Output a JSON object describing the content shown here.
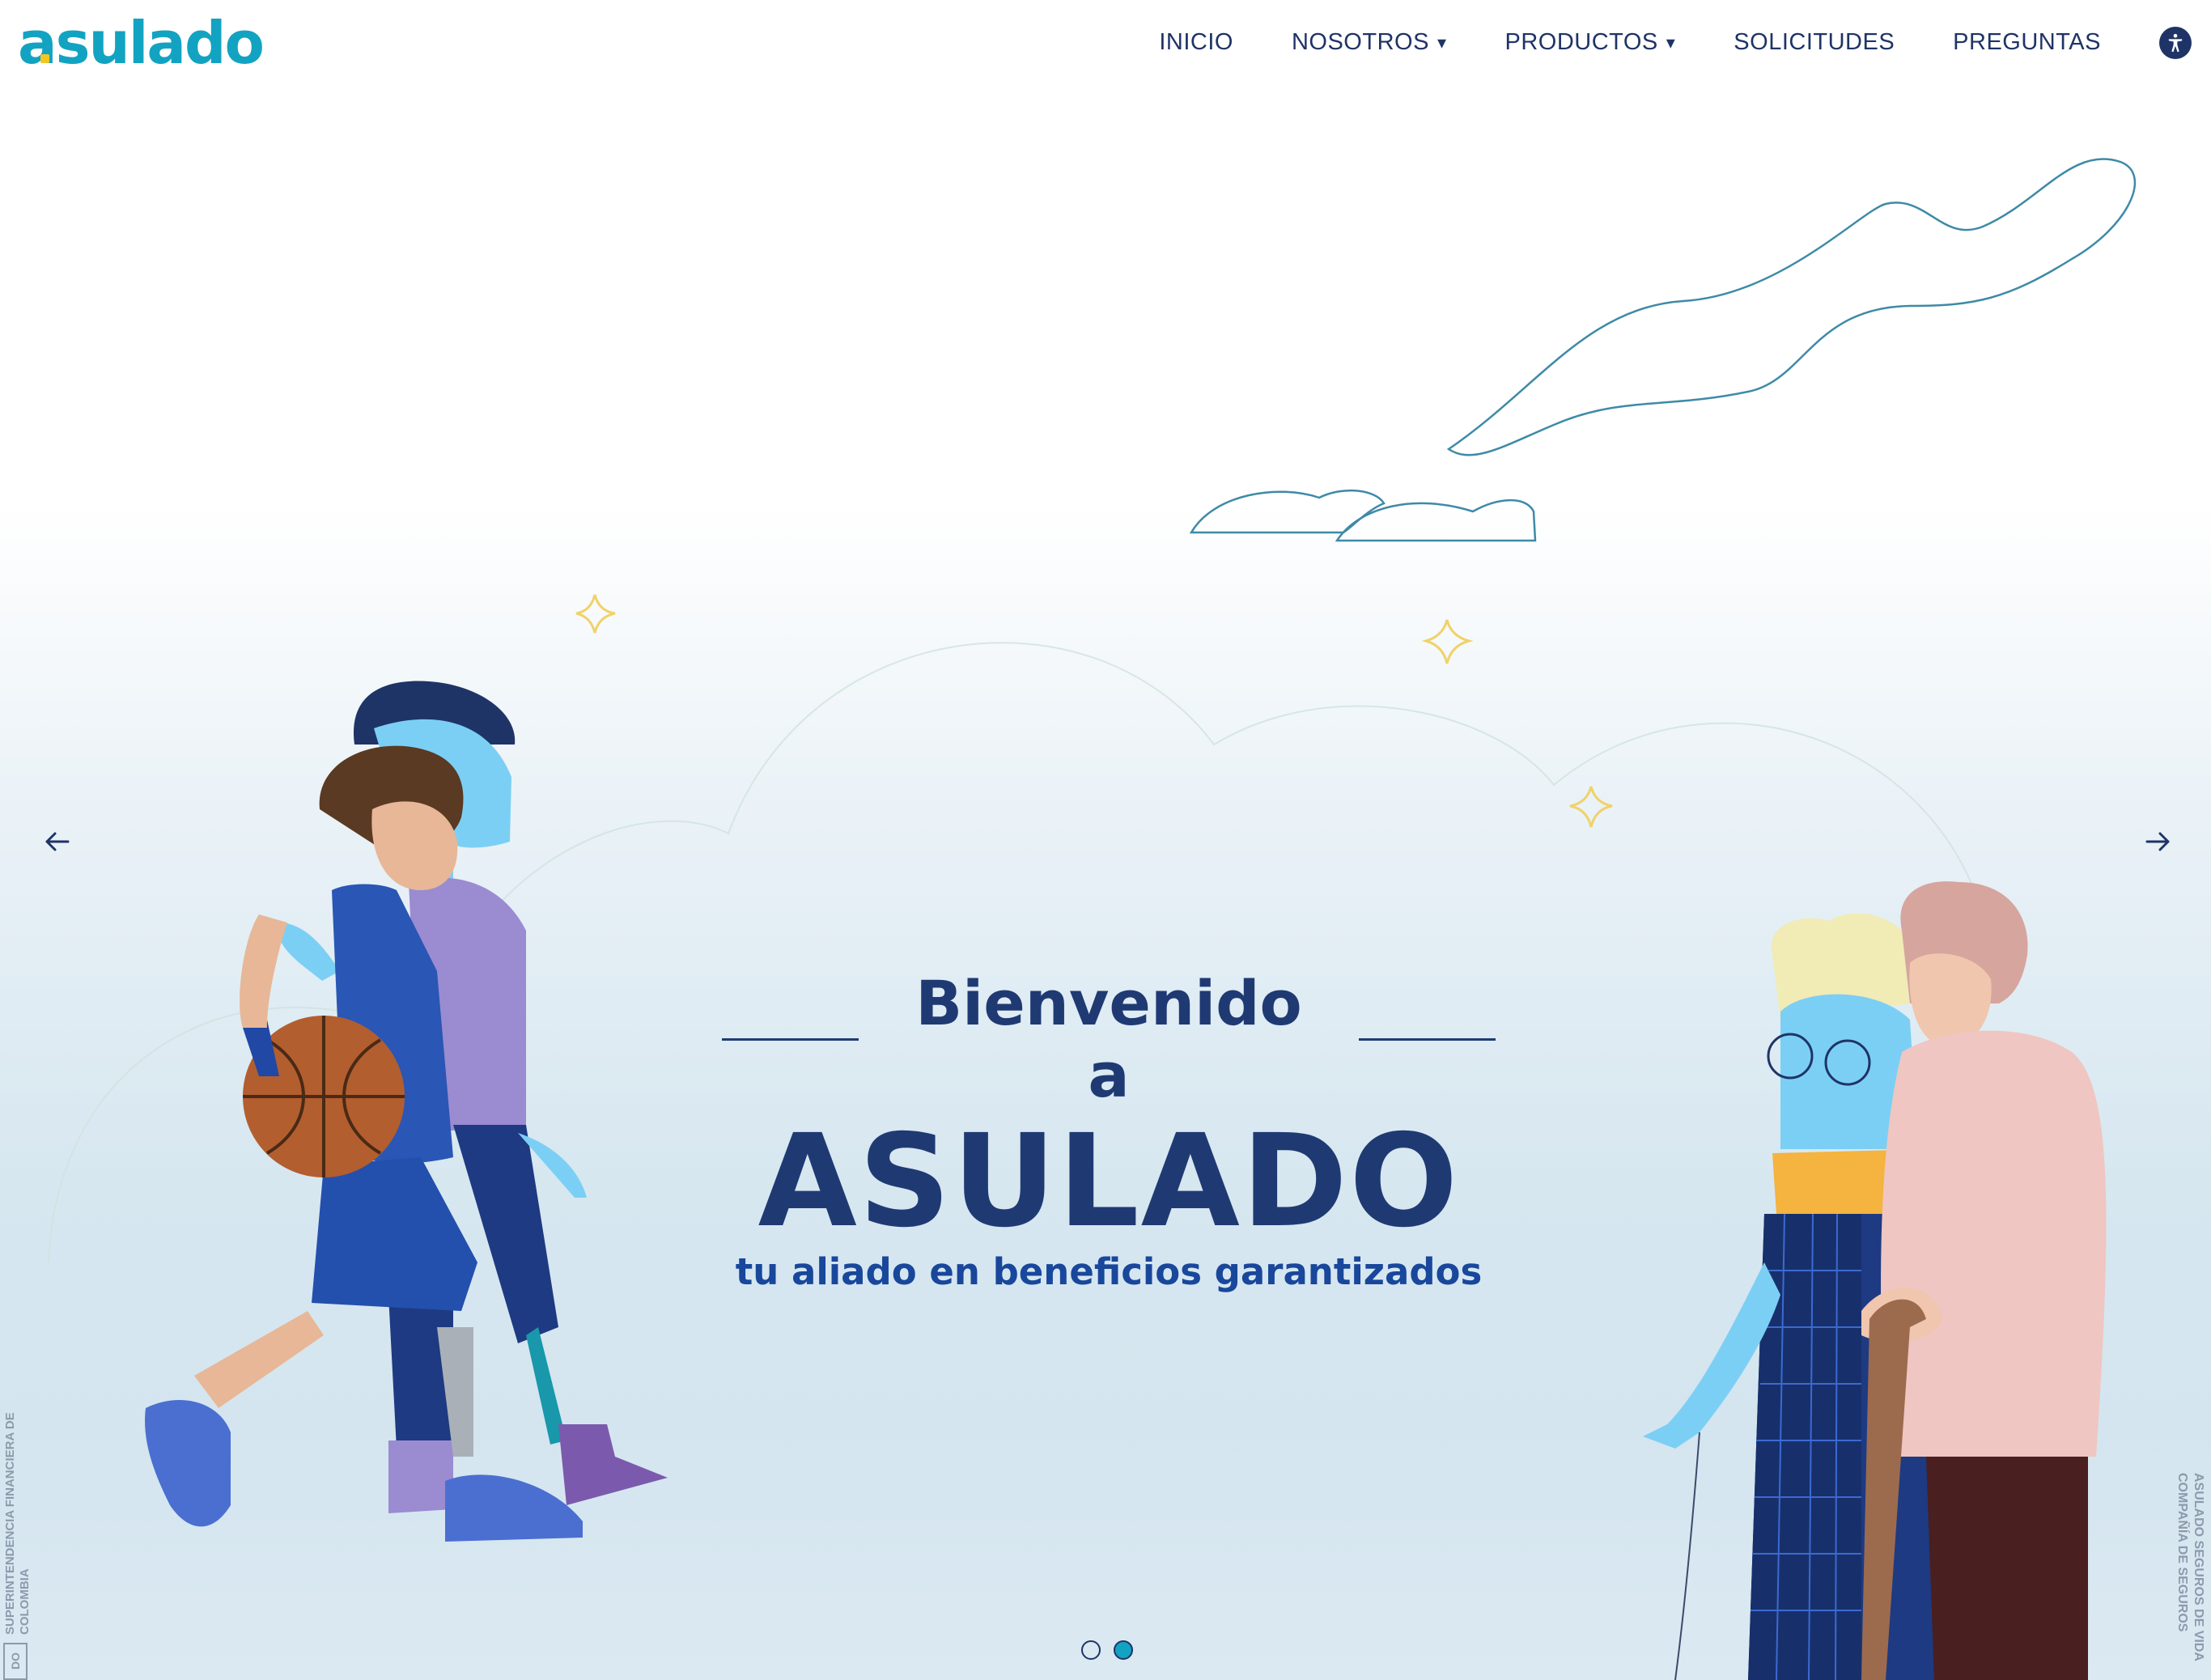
{
  "brand": {
    "logo_text": "asulado",
    "accent": "#13a3c2",
    "navy": "#1f3466",
    "yellow": "#f3c623"
  },
  "nav": {
    "items": [
      {
        "label": "INICIO",
        "caret": ""
      },
      {
        "label": "NOSOTROS",
        "caret": "▾"
      },
      {
        "label": "PRODUCTOS",
        "caret": "▾"
      },
      {
        "label": "SOLICITUDES",
        "caret": ""
      },
      {
        "label": "PREGUNTAS",
        "caret": ""
      }
    ],
    "accessibility_icon": "accessibility-icon"
  },
  "hero": {
    "line1": "Bienvenido a",
    "title": "ASULADO",
    "subtitle": "tu aliado en beneficios garantizados"
  },
  "carousel": {
    "prev_icon": "arrow-left-icon",
    "next_icon": "arrow-right-icon",
    "slides_total": 2,
    "active_slide": 2
  },
  "side_notes": {
    "left": "SUPERINTENDENCIA FINANCIERA DE COLOMBIA",
    "left_mark": "DO",
    "right": "ASULADO SEGUROS DE VIDA COMPAÑÍA DE SEGUROS"
  }
}
